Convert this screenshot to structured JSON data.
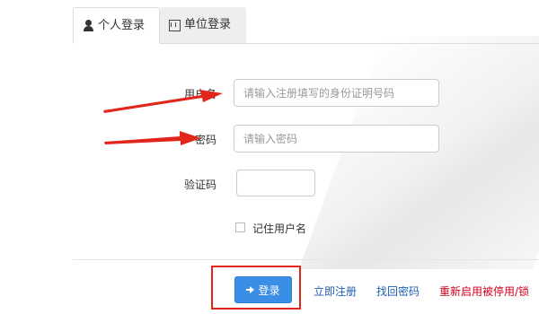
{
  "tabs": [
    {
      "label": "个人登录",
      "icon": "user-icon"
    },
    {
      "label": "单位登录",
      "icon": "building-icon"
    }
  ],
  "form": {
    "username_label": "用户名",
    "username_placeholder": "请输入注册填写的身份证明号码",
    "password_label": "密码",
    "password_placeholder": "请输入密码",
    "captcha_label": "验证码",
    "remember_label": "记住用户名"
  },
  "actions": {
    "login_label": "登录",
    "register_label": "立即注册",
    "recover_label": "找回密码",
    "reenable_label": "重新启用被停用/锁"
  },
  "colors": {
    "annotation": "#e1261c",
    "primary_button": "#3b8ee6",
    "link_blue": "#1f5fb3",
    "link_red": "#d0021b"
  }
}
